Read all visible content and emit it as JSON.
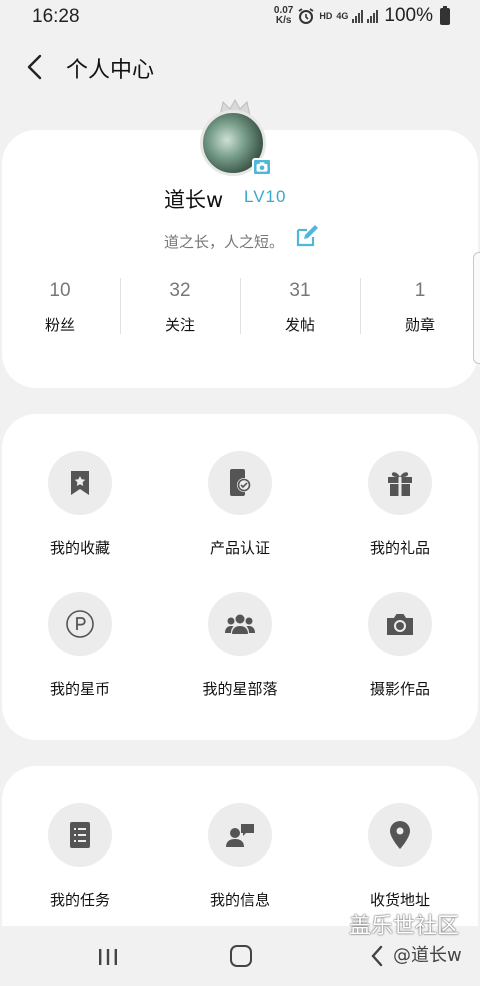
{
  "status": {
    "time": "16:28",
    "speed_value": "0.07",
    "speed_unit": "K/s",
    "hd": "HD",
    "net": "4G",
    "battery": "100%"
  },
  "header": {
    "title": "个人中心"
  },
  "profile": {
    "nickname": "道长w",
    "level": "LV10",
    "signature": "道之长，人之短。",
    "stats": [
      {
        "value": "10",
        "label": "粉丝"
      },
      {
        "value": "32",
        "label": "关注"
      },
      {
        "value": "31",
        "label": "发帖"
      },
      {
        "value": "1",
        "label": "勋章"
      }
    ]
  },
  "menu1": [
    {
      "label": "我的收藏",
      "icon": "bookmark-star-icon"
    },
    {
      "label": "产品认证",
      "icon": "device-check-icon"
    },
    {
      "label": "我的礼品",
      "icon": "gift-icon"
    },
    {
      "label": "我的星币",
      "icon": "coin-p-icon"
    },
    {
      "label": "我的星部落",
      "icon": "group-icon"
    },
    {
      "label": "摄影作品",
      "icon": "camera-icon"
    }
  ],
  "menu2": [
    {
      "label": "我的任务",
      "icon": "task-list-icon"
    },
    {
      "label": "我的信息",
      "icon": "message-user-icon"
    },
    {
      "label": "收货地址",
      "icon": "location-pin-icon"
    }
  ],
  "overlay": {
    "watermark": "盖乐世社区",
    "handle": "@道长w"
  },
  "colors": {
    "accent": "#3aa8c9",
    "card": "#ffffff",
    "background": "#f1f1f1",
    "icon": "#555555"
  }
}
